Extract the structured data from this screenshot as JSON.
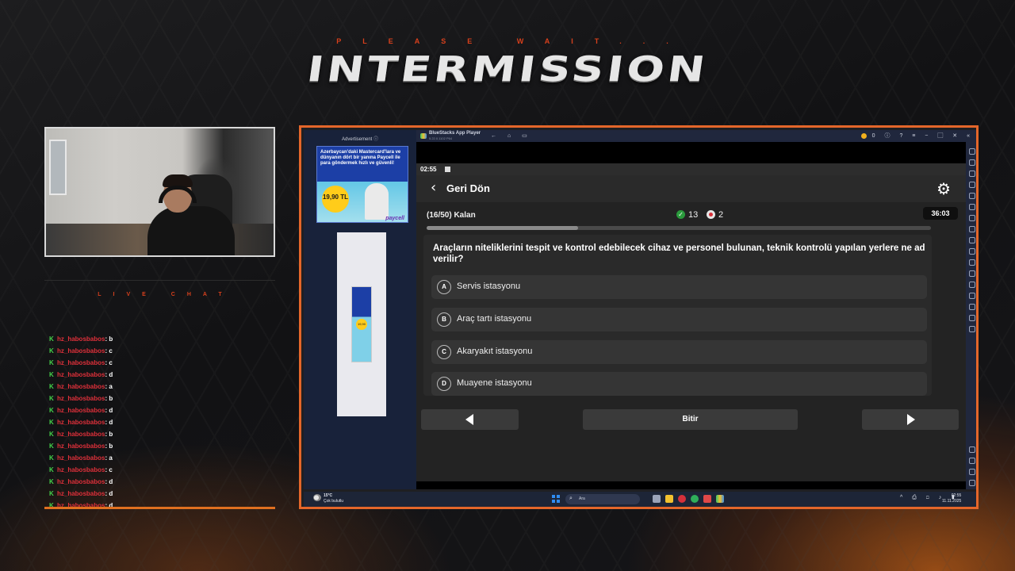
{
  "overlay": {
    "please_wait": "PLEASE WAIT...",
    "title": "INTERMISSION",
    "live_chat_label": "LIVE CHAT"
  },
  "chat": {
    "messages": [
      {
        "user": "hz_habosbabos",
        "msg": ": b"
      },
      {
        "user": "hz_habosbabos",
        "msg": ": c"
      },
      {
        "user": "hz_habosbabos",
        "msg": ": c"
      },
      {
        "user": "hz_habosbabos",
        "msg": ": d"
      },
      {
        "user": "hz_habosbabos",
        "msg": ": a"
      },
      {
        "user": "hz_habosbabos",
        "msg": ": b"
      },
      {
        "user": "hz_habosbabos",
        "msg": ": d"
      },
      {
        "user": "hz_habosbabos",
        "msg": ": d"
      },
      {
        "user": "hz_habosbabos",
        "msg": ": b"
      },
      {
        "user": "hz_habosbabos",
        "msg": ": b"
      },
      {
        "user": "hz_habosbabos",
        "msg": ": a"
      },
      {
        "user": "hz_habosbabos",
        "msg": ": c"
      },
      {
        "user": "hz_habosbabos",
        "msg": ": d"
      },
      {
        "user": "hz_habosbabos",
        "msg": ": d"
      },
      {
        "user": "hz_habosbabos",
        "msg": ": d"
      }
    ]
  },
  "ad": {
    "title": "Advertisement ⓘ",
    "headline": "Azerbaycan'daki Mastercard'lara ve dünyanın dört bir yanına Paycell ile para göndermek hızlı ve güvenli!",
    "price": "19,90 TL",
    "brand": "paycell"
  },
  "bluestacks": {
    "title": "BlueStacks App Player",
    "subtitle": "5.22.0.1102 P64",
    "nav_icons": [
      "back-icon",
      "home-icon",
      "multitask-icon"
    ],
    "coins": "0",
    "right_icons": "ⓘ ? ≡ − ▢ ✕ «"
  },
  "android": {
    "time": "02:55"
  },
  "quiz": {
    "back_label": "Geri Dön",
    "progress_text": "(16/50) Kalan",
    "correct_count": "13",
    "wrong_count": "2",
    "timer": "36:03",
    "progress_fraction": 0.3,
    "question": "Araçların niteliklerini tespit ve kontrol edebilecek cihaz ve personel bulunan, teknik kontrolü yapılan yerlere ne ad verilir?",
    "options": [
      {
        "letter": "A",
        "text": "Servis istasyonu"
      },
      {
        "letter": "B",
        "text": "Araç tartı istasyonu"
      },
      {
        "letter": "C",
        "text": "Akaryakıt istasyonu"
      },
      {
        "letter": "D",
        "text": "Muayene istasyonu"
      }
    ],
    "finish_label": "Bitir"
  },
  "taskbar": {
    "weather_temp": "15°C",
    "weather_desc": "Çok bulutlu",
    "search_placeholder": "Ara",
    "tray": "^ ⎙ ◻ ♪ ▮",
    "clock_time": "02:55",
    "clock_date": "11.11.2025"
  },
  "colors": {
    "accent_orange": "#e4662a",
    "chat_user": "#e0303a",
    "chat_badge": "#44d34a",
    "correct": "#2a9a3c",
    "wrong": "#d6303a"
  }
}
